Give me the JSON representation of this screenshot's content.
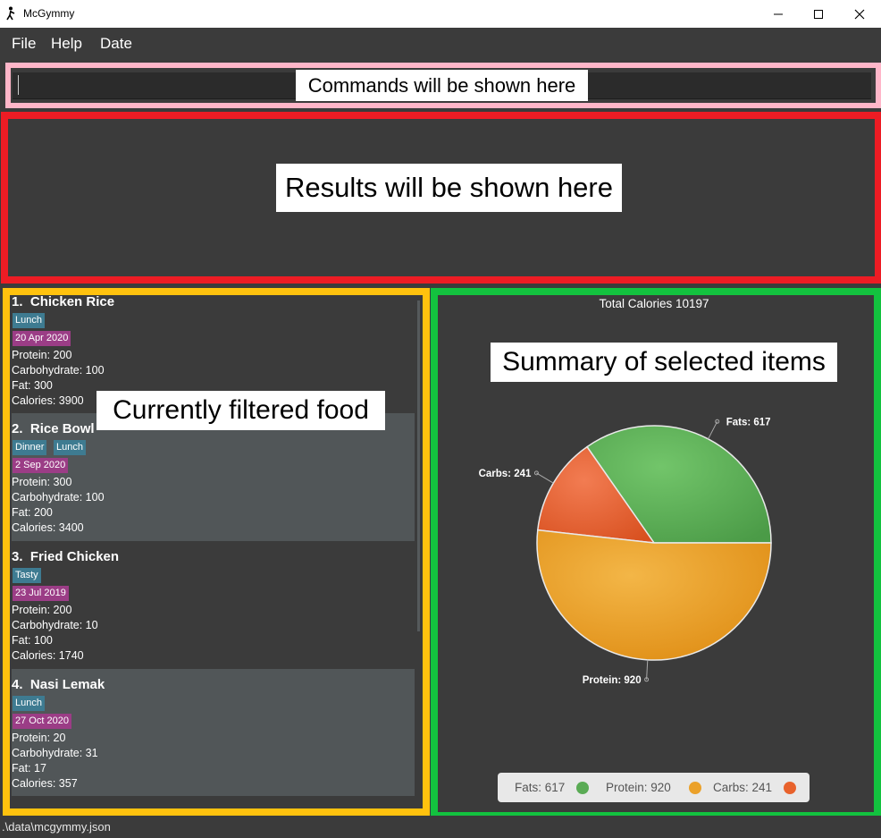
{
  "window": {
    "title": "McGymmy"
  },
  "menu": {
    "file": "File",
    "help": "Help",
    "date": "Date"
  },
  "command_box": {
    "label": "Commands will be shown here",
    "value": ""
  },
  "result_box": {
    "label": "Results will be shown here"
  },
  "food_list": {
    "label": "Currently filtered food",
    "items": [
      {
        "index": "1.",
        "name": "Chicken Rice",
        "tags": [
          "Lunch"
        ],
        "date": "20 Apr 2020",
        "protein": "Protein: 200",
        "carbs": "Carbohydrate: 100",
        "fat": "Fat: 300",
        "calories": "Calories: 3900"
      },
      {
        "index": "2.",
        "name": "Rice Bowl",
        "tags": [
          "Dinner",
          "Lunch"
        ],
        "date": "2 Sep 2020",
        "protein": "Protein: 300",
        "carbs": "Carbohydrate: 100",
        "fat": "Fat: 200",
        "calories": "Calories: 3400"
      },
      {
        "index": "3.",
        "name": "Fried Chicken",
        "tags": [
          "Tasty"
        ],
        "date": "23 Jul 2019",
        "protein": "Protein: 200",
        "carbs": "Carbohydrate: 10",
        "fat": "Fat: 100",
        "calories": "Calories: 1740"
      },
      {
        "index": "4.",
        "name": "Nasi Lemak",
        "tags": [
          "Lunch"
        ],
        "date": "27 Oct 2020",
        "protein": "Protein: 20",
        "carbs": "Carbohydrate: 31",
        "fat": "Fat: 17",
        "calories": "Calories: 357"
      }
    ]
  },
  "summary": {
    "label": "Summary of selected items",
    "chart_title": "Total Calories 10197",
    "legend": [
      "Fats: 617",
      "Protein: 920",
      "Carbs: 241"
    ]
  },
  "chart_data": {
    "type": "pie",
    "title": "Total Calories 10197",
    "slices": [
      {
        "label": "Fats: 617",
        "value": 617,
        "color": "#5aab55"
      },
      {
        "label": "Carbs: 241",
        "value": 241,
        "color": "#e8622c"
      },
      {
        "label": "Protein: 920",
        "value": 920,
        "color": "#eba12a"
      }
    ],
    "legend_position": "bottom"
  },
  "colors": {
    "fats": "#5aab55",
    "protein": "#eba12a",
    "carbs": "#e8622c",
    "tag": "#3e7b91",
    "date": "#9b3d86"
  },
  "status": {
    "path": ".\\data\\mcgymmy.json"
  }
}
